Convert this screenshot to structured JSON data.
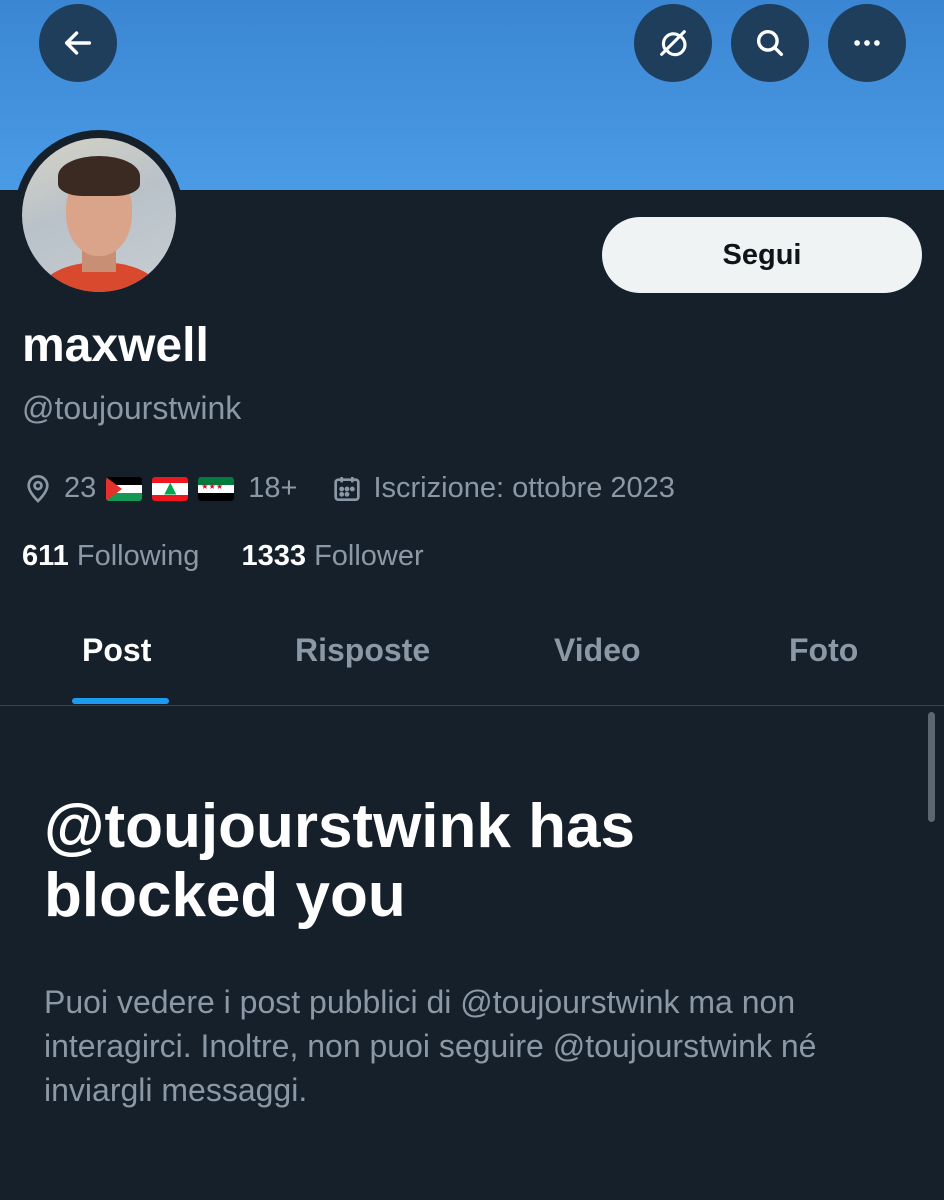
{
  "header": {
    "icons": {
      "back": "back-arrow-icon",
      "grok": "grok-icon",
      "search": "search-icon",
      "more": "more-icon"
    }
  },
  "profile": {
    "display_name": "maxwell",
    "handle": "@toujourstwink",
    "follow_label": "Segui",
    "location_text": "23",
    "flags": [
      "flag-palestine",
      "flag-lebanon",
      "flag-syria"
    ],
    "age_text": "18+",
    "joined_text": "Iscrizione: ottobre 2023",
    "following_count": "611",
    "following_label": "Following",
    "follower_count": "1333",
    "follower_label": "Follower"
  },
  "tabs": [
    {
      "label": "Post",
      "active": true
    },
    {
      "label": "Risposte",
      "active": false
    },
    {
      "label": "Video",
      "active": false
    },
    {
      "label": "Foto",
      "active": false
    }
  ],
  "blocked": {
    "title": "@toujourstwink has blocked you",
    "description": "Puoi vedere i post pubblici di @toujourstwink ma non interagirci. Inoltre, non puoi seguire @toujourstwink né inviargli messaggi."
  },
  "colors": {
    "background": "#15202b",
    "banner": "#4a9be6",
    "accent": "#1d9bf0",
    "muted_text": "#8b98a5"
  }
}
